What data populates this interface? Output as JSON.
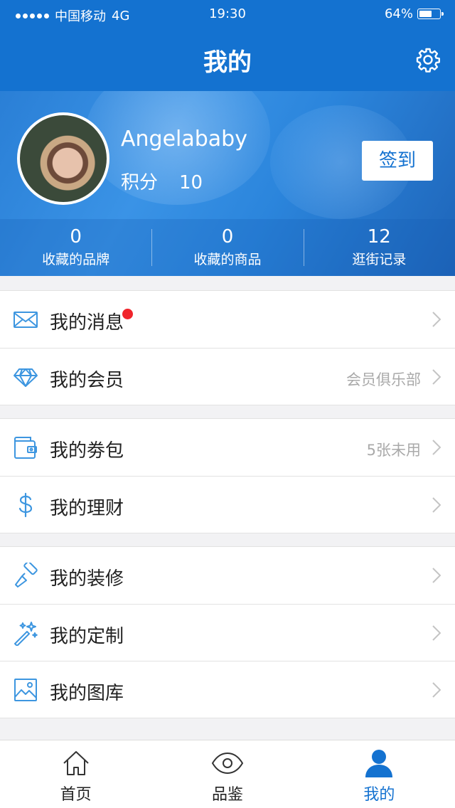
{
  "status_bar": {
    "carrier": "中国移动",
    "network": "4G",
    "time": "19:30",
    "battery": "64%",
    "battery_level": 0.64
  },
  "nav": {
    "title": "我的",
    "settings_icon": "gear-icon"
  },
  "profile": {
    "username": "Angelababy",
    "points_label": "积分",
    "points_value": "10",
    "checkin_label": "签到",
    "stats": [
      {
        "value": "0",
        "label": "收藏的品牌"
      },
      {
        "value": "0",
        "label": "收藏的商品"
      },
      {
        "value": "12",
        "label": "逛街记录"
      }
    ]
  },
  "menu": {
    "messages": {
      "label": "我的消息",
      "icon": "mail-icon",
      "has_badge": true
    },
    "membership": {
      "label": "我的会员",
      "icon": "diamond-icon",
      "sub": "会员俱乐部"
    },
    "coupons": {
      "label": "我的劵包",
      "icon": "wallet-icon",
      "sub": "5张未用"
    },
    "finance": {
      "label": "我的理财",
      "icon": "dollar-icon"
    },
    "decoration": {
      "label": "我的装修",
      "icon": "paint-roller-icon"
    },
    "custom": {
      "label": "我的定制",
      "icon": "magic-wand-icon"
    },
    "gallery": {
      "label": "我的图库",
      "icon": "image-icon"
    }
  },
  "tabbar": [
    {
      "label": "首页",
      "icon": "home-icon",
      "active": false
    },
    {
      "label": "品鉴",
      "icon": "eye-icon",
      "active": false
    },
    {
      "label": "我的",
      "icon": "user-icon",
      "active": true
    }
  ],
  "colors": {
    "primary": "#1472d0",
    "badge": "#f0242b",
    "muted": "#aaaaaa"
  }
}
